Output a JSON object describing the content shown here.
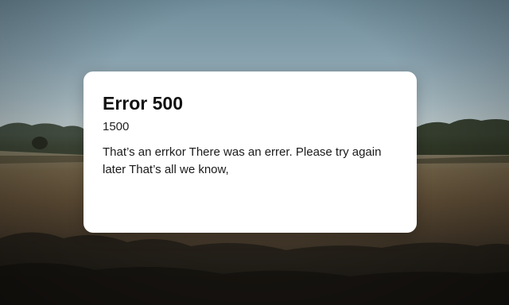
{
  "background": {
    "scene": "field-landscape",
    "colors": {
      "sky": "#86a0ad",
      "horizon": "#b9c3c1",
      "field": "#6e5f45",
      "foreground": "#2e2821"
    }
  },
  "dialog": {
    "title": "Error 500",
    "code": "1500",
    "message": "That’s an errkor There was an errer. Please try again later That’s all we know,",
    "background_color": "#ffffff"
  }
}
